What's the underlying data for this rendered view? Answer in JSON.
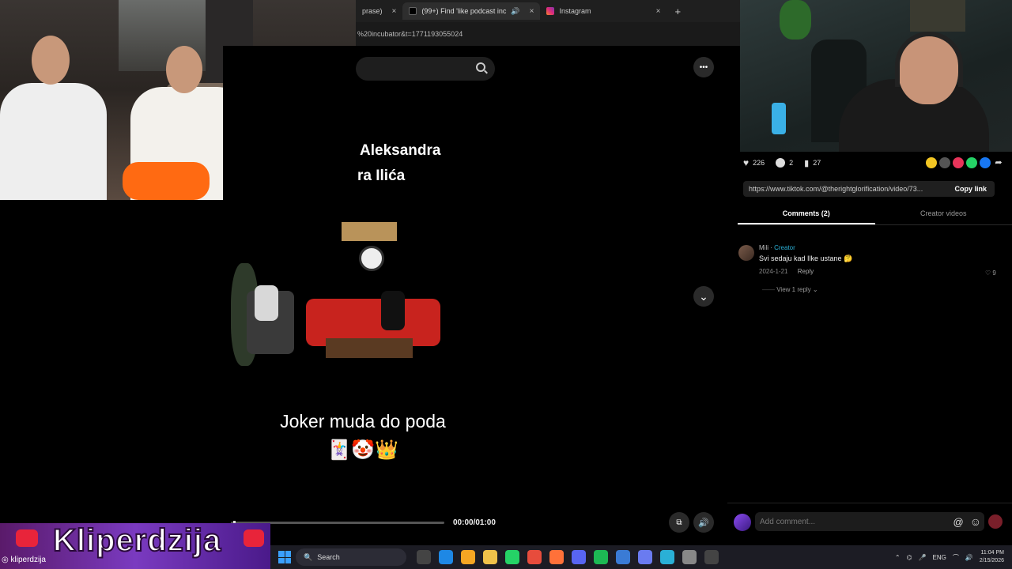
{
  "browser": {
    "tabs": [
      {
        "label": "prase)",
        "close": "×"
      },
      {
        "label": "(99+) Find 'like podcast inc",
        "close": "×"
      },
      {
        "label": "Instagram",
        "close": "×"
      }
    ],
    "new_tab": "+",
    "url": "%20incubator&t=1771193055024"
  },
  "video": {
    "overlay_line1": "Aleksandra",
    "overlay_line2": "ra Ilića",
    "caption": "Joker muda do poda",
    "emojis": "🃏🤡👑",
    "time": "00:00/01:00",
    "progress": 0.01,
    "more_icon": "•••",
    "next_icon": "⌄"
  },
  "sidebar": {
    "likes": "226",
    "comments": "2",
    "saves": "27",
    "link": "https://www.tiktok.com/@therightglorification/video/73...",
    "copy_link": "Copy link",
    "tab_comments": "Comments (2)",
    "tab_creator": "Creator videos",
    "comment": {
      "author": "Mili",
      "badge": "Creator",
      "text": "Svi sedaju kad Ilke ustane 🤔",
      "date": "2024-1-21",
      "reply": "Reply",
      "likes": "9",
      "view_replies": "View 1 reply"
    },
    "add_comment_placeholder": "Add comment...",
    "at_icon": "@",
    "emoji_icon": "☺"
  },
  "overlay": {
    "brand": "Kliperdzija",
    "handle": "kliperdzija"
  },
  "taskbar": {
    "search": "Search",
    "lang": "ENG",
    "time": "11:04 PM",
    "date": "2/15/2026"
  },
  "colors": {
    "tiktok_accent": "#2ab0d6",
    "studio_couch": "#c8231e",
    "overlay_purple": "#7a3ac0"
  }
}
